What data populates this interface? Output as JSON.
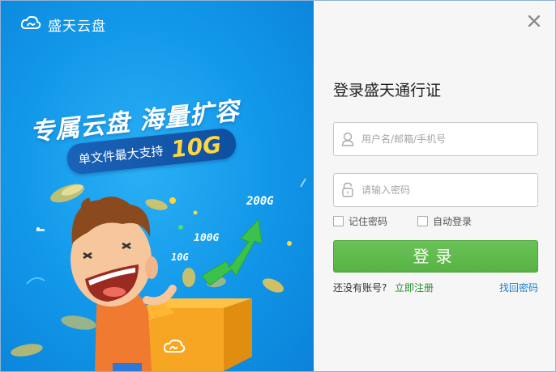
{
  "app": {
    "brand_name": "盛天云盘"
  },
  "promo": {
    "slogan": "专属云盘 海量扩容",
    "pill_text": "单文件最大支持",
    "pill_size": "10G",
    "chart_labels": [
      "200G",
      "100G",
      "10G"
    ]
  },
  "login": {
    "title": "登录盛天通行证",
    "username_placeholder": "用户名/邮箱/手机号",
    "password_placeholder": "请输入密码",
    "remember_label": "记住密码",
    "auto_login_label": "自动登录",
    "submit_label": "登录",
    "no_account_text": "还没有账号?",
    "register_label": "立即注册",
    "forgot_label": "找回密码"
  },
  "colors": {
    "promo_blue": "#1196e8",
    "login_green": "#57b243",
    "link_green": "#2a8d2a",
    "link_blue": "#1b7fd0",
    "accent_yellow": "#ffd640"
  },
  "icons": {
    "brand": "cloud-logo-icon",
    "close": "close-icon",
    "user": "user-icon",
    "password": "lock-icon"
  }
}
